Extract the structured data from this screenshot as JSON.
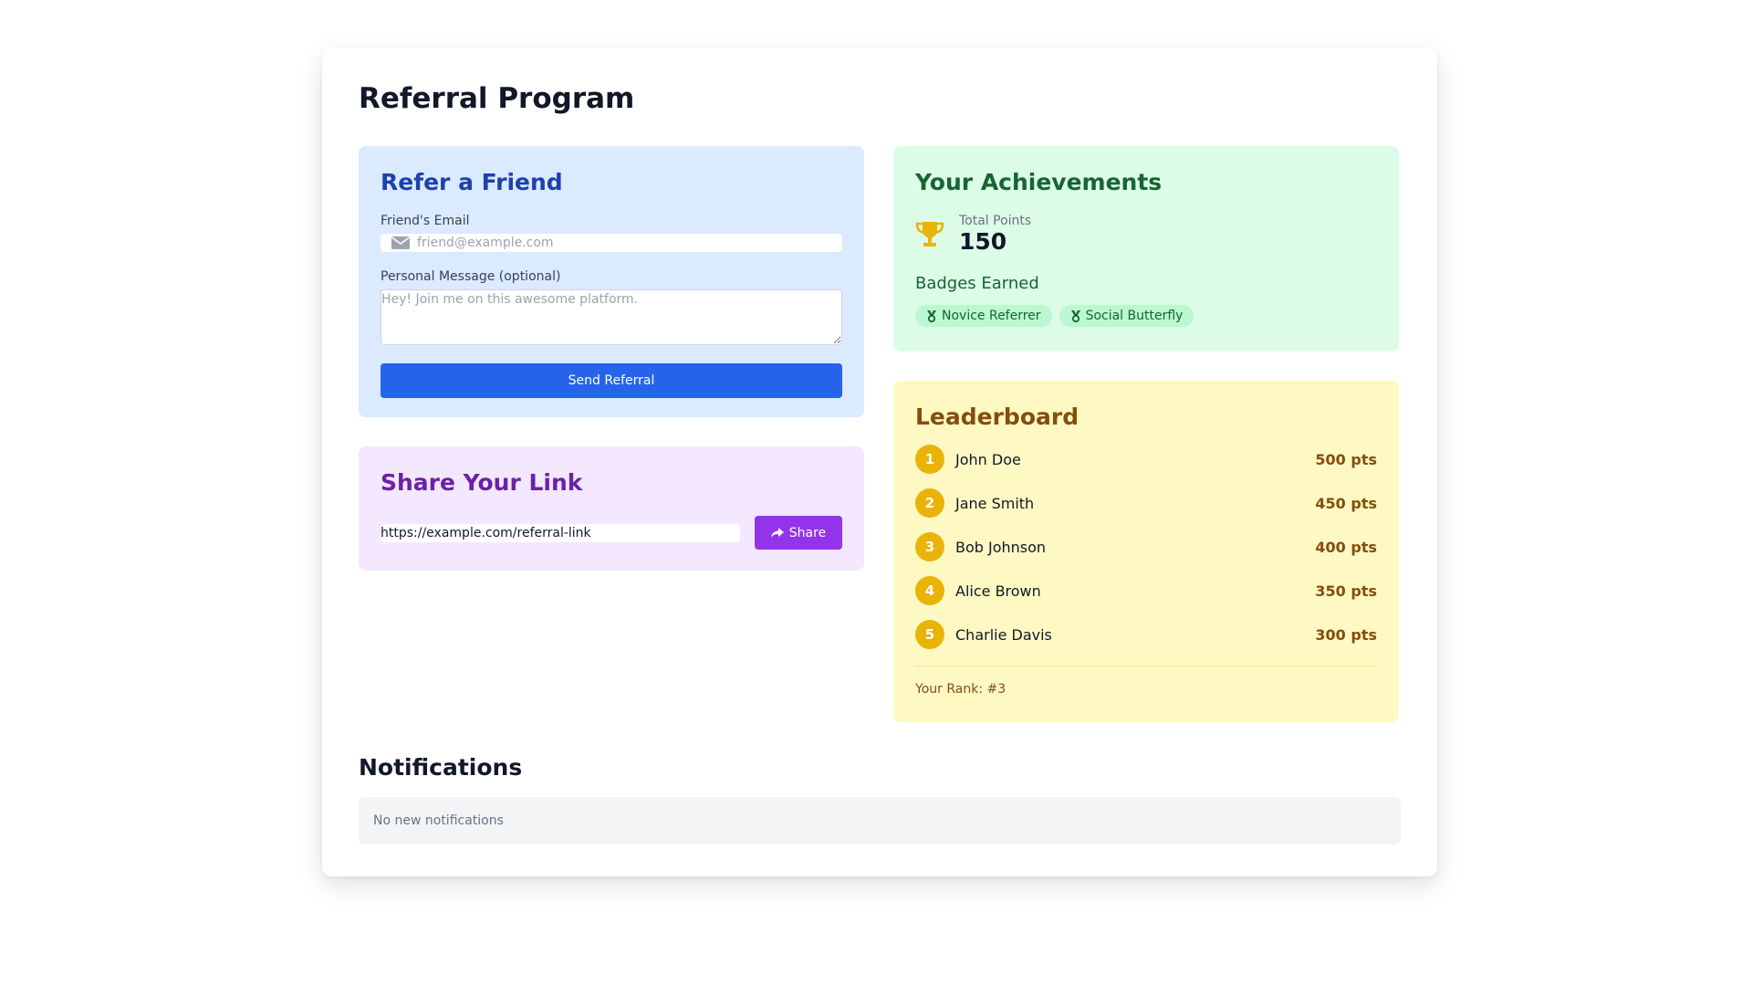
{
  "page": {
    "title": "Referral Program"
  },
  "refer": {
    "title": "Refer a Friend",
    "email_label": "Friend's Email",
    "email_placeholder": "friend@example.com",
    "message_label": "Personal Message (optional)",
    "message_placeholder": "Hey! Join me on this awesome platform.",
    "send_label": "Send Referral"
  },
  "share": {
    "title": "Share Your Link",
    "link_value": "https://example.com/referral-link",
    "share_label": "Share"
  },
  "achievements": {
    "title": "Your Achievements",
    "points_label": "Total Points",
    "points_value": "150",
    "badges_title": "Badges Earned",
    "badges": [
      {
        "label": "Novice Referrer",
        "icon": "medal-icon"
      },
      {
        "label": "Social Butterfly",
        "icon": "medal-icon"
      }
    ]
  },
  "leaderboard": {
    "title": "Leaderboard",
    "entries": [
      {
        "rank": "1",
        "name": "John Doe",
        "points": "500 pts"
      },
      {
        "rank": "2",
        "name": "Jane Smith",
        "points": "450 pts"
      },
      {
        "rank": "3",
        "name": "Bob Johnson",
        "points": "400 pts"
      },
      {
        "rank": "4",
        "name": "Alice Brown",
        "points": "350 pts"
      },
      {
        "rank": "5",
        "name": "Charlie Davis",
        "points": "300 pts"
      }
    ],
    "your_rank": "Your Rank: #3"
  },
  "notifications": {
    "title": "Notifications",
    "empty_text": "No new notifications"
  },
  "colors": {
    "refer_bg": "#dbeafe",
    "share_bg": "#f3e8ff",
    "achievements_bg": "#dcfce7",
    "leaderboard_bg": "#fef9c3",
    "primary_button": "#2563eb",
    "share_button": "#9333ea",
    "rank_circle": "#eab308"
  }
}
